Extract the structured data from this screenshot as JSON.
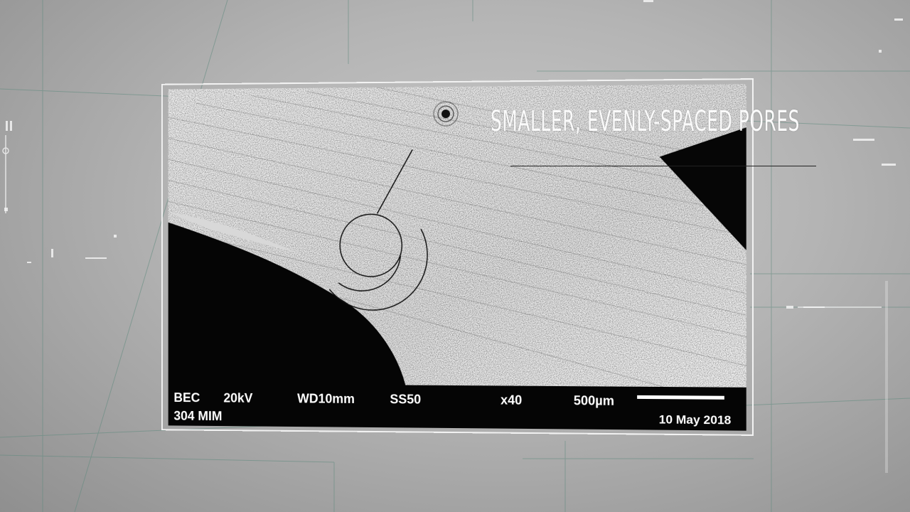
{
  "caption": "SMALLER, EVENLY-SPACED PORES",
  "sem_info": {
    "mode": "BEC",
    "voltage": "20kV",
    "working_distance": "WD10mm",
    "spot_size": "SS50",
    "magnification": "x40",
    "scale_label": "500µm",
    "sample": "304 MIM",
    "date": "10 May 2018"
  },
  "colors": {
    "background": "#b4b4b4",
    "hud_lines": "#5f8a7e",
    "frame_border": "#f2f2f2",
    "databar": "#050505"
  }
}
